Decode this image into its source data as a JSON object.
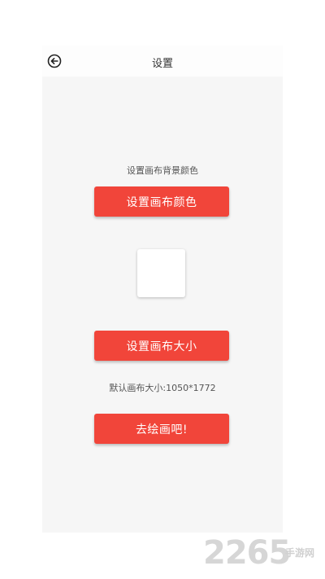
{
  "header": {
    "title": "设置",
    "back_icon": "back-arrow-circle-icon"
  },
  "settings": {
    "background_label": "设置画布背景颜色",
    "color_button_label": "设置画布颜色",
    "swatch_color": "#ffffff",
    "size_button_label": "设置画布大小",
    "default_size_label": "默认画布大小:1050*1772",
    "draw_button_label": "去绘画吧!"
  },
  "watermark": {
    "number": "2265",
    "text": "手游网"
  },
  "colors": {
    "accent": "#f1453a",
    "panel": "#f6f6f6",
    "text": "#333333"
  }
}
